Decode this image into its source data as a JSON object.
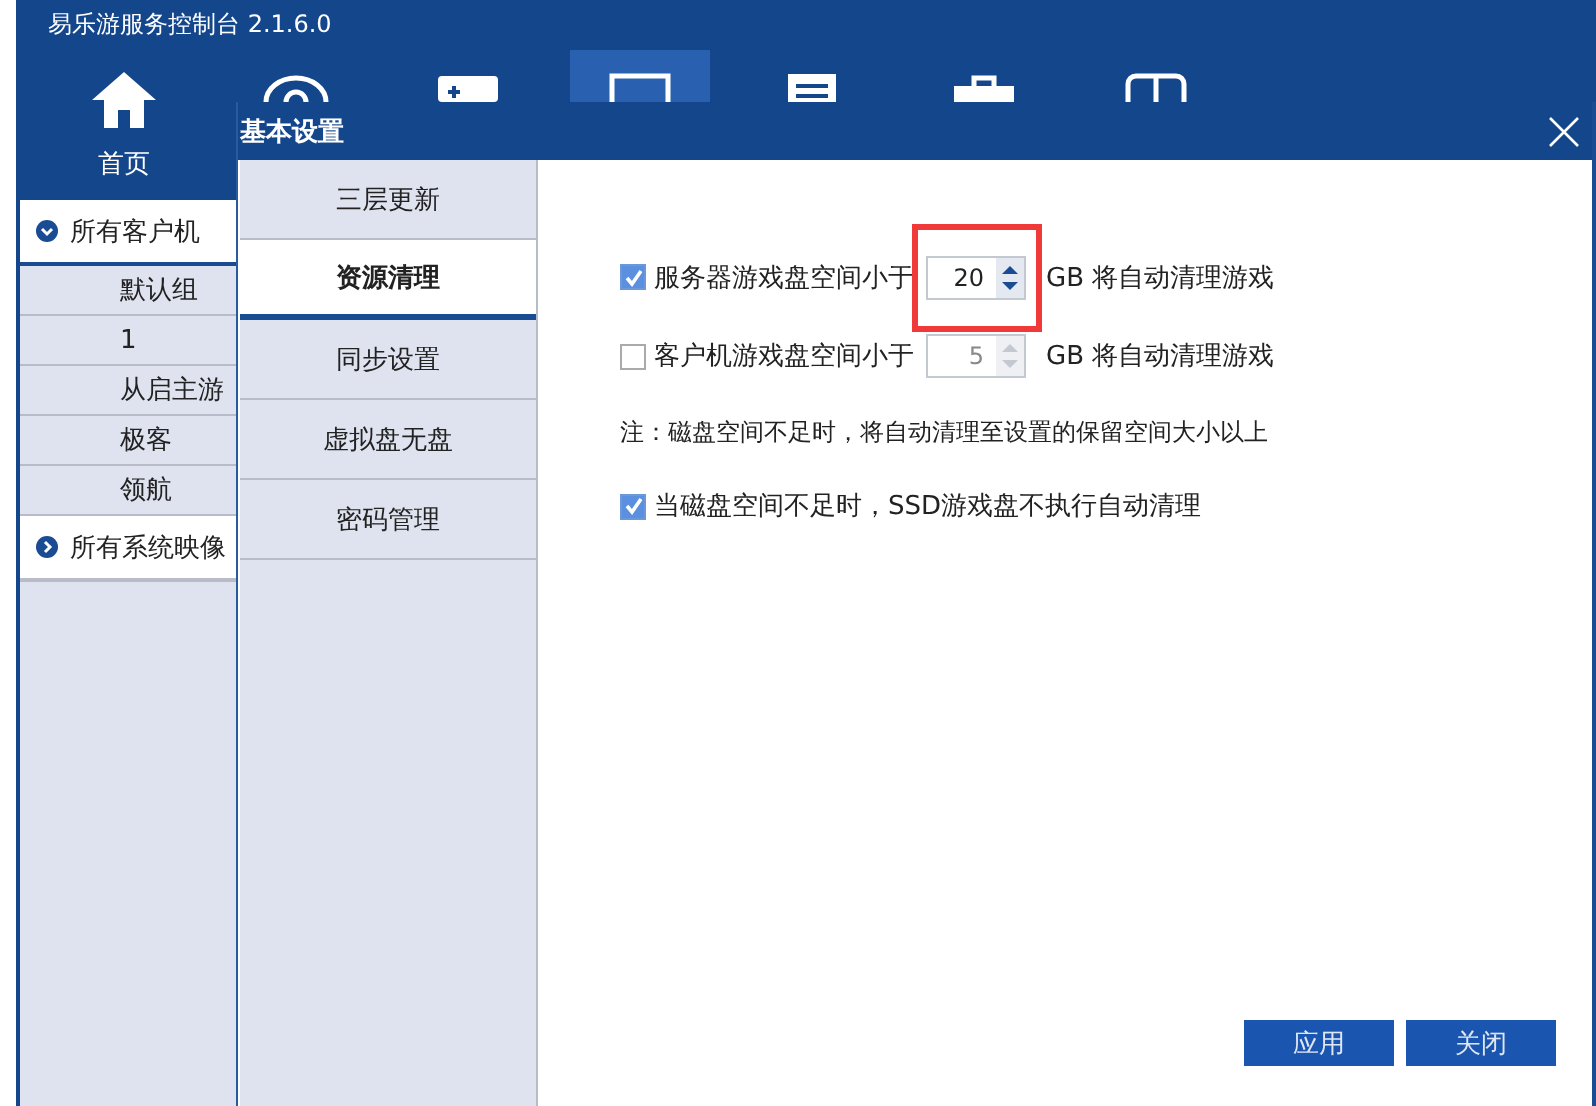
{
  "app": {
    "title": "易乐游服务控制台 2.1.6.0"
  },
  "nav": {
    "items": [
      {
        "label": "首页",
        "selected": false
      },
      {
        "selected": false
      },
      {
        "selected": false
      },
      {
        "selected": true
      },
      {
        "selected": false
      },
      {
        "selected": false
      },
      {
        "selected": false
      }
    ]
  },
  "sidebar": {
    "groups": [
      {
        "label": "所有客户机",
        "expanded": true,
        "children": [
          {
            "label": "默认组"
          },
          {
            "label": "1"
          },
          {
            "label": "从启主游"
          },
          {
            "label": "极客"
          },
          {
            "label": "领航"
          }
        ]
      },
      {
        "label": "所有系统映像",
        "expanded": false
      }
    ]
  },
  "dialog": {
    "title": "基本设置",
    "tabs": [
      {
        "label": "三层更新",
        "selected": false
      },
      {
        "label": "资源清理",
        "selected": true
      },
      {
        "label": "同步设置",
        "selected": false
      },
      {
        "label": "虚拟盘无盘",
        "selected": false
      },
      {
        "label": "密码管理",
        "selected": false
      }
    ],
    "settings": [
      {
        "kind": "spin",
        "checked": true,
        "disabled": false,
        "highlighted": true,
        "label": "服务器游戏盘空间小于",
        "value": "20",
        "unit": "GB 将自动清理游戏"
      },
      {
        "kind": "spin",
        "checked": false,
        "disabled": true,
        "highlighted": false,
        "label": "客户机游戏盘空间小于",
        "value": "5",
        "unit": "GB 将自动清理游戏"
      },
      {
        "kind": "note",
        "text": "注：磁盘空间不足时，将自动清理至设置的保留空间大小以上"
      },
      {
        "kind": "check",
        "checked": true,
        "label": "当磁盘空间不足时，SSD游戏盘不执行自动清理"
      }
    ],
    "buttons": [
      {
        "label": "应用"
      },
      {
        "label": "关闭"
      }
    ]
  }
}
